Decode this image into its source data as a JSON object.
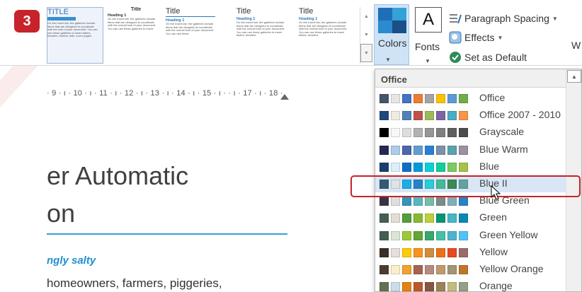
{
  "step_badge": "3",
  "ribbon": {
    "styles": [
      {
        "title": "TITLE",
        "heading": "",
        "body": "On the Insert tab, the galleries include items that are designed to coordinate with the look of your document. You can use these galleries to insert tables, headers, footers, lists, cover pages."
      },
      {
        "title": "Title",
        "heading": "Heading 1",
        "body": "On the Insert tab, the galleries include items that are designed to coordinate with the overall look of your document. You can use these galleries to insert"
      },
      {
        "title": "Title",
        "heading": "Heading 1",
        "body": "On the Insert tab, the galleries include items that are designed to coordinate with the overall look of your document. You can use these"
      },
      {
        "title": "Title",
        "heading": "Heading 1",
        "body": "On the Insert tab, the galleries include items that are designed to coordinate with the overall look of your document. You can use these galleries to insert tables, headers."
      },
      {
        "title": "Title",
        "heading": "Heading 1",
        "body": "On the Insert tab, the galleries include items that are designed to coordinate with the overall look of your document. You can use these galleries to insert tables, headers."
      }
    ],
    "colors_label": "Colors",
    "fonts_label": "Fonts",
    "fonts_glyph": "A",
    "paragraph_spacing": "Paragraph Spacing",
    "effects": "Effects",
    "set_as_default": "Set as Default",
    "w_fragment": "W"
  },
  "ruler": "· 9 · ı · 10 · ı · 11 · ı · 12 · ı · 13 · ı · 14 · ı · 15 · ı ·     · ı · 17 · ı · 18 ·",
  "document": {
    "title_line1": "er Automatic",
    "title_line2": "on",
    "subtitle": "ngly salty",
    "body": "homeowners, farmers, piggeries,"
  },
  "dropdown": {
    "header": "Office",
    "selected_index": 5,
    "themes": [
      {
        "name": "Office",
        "colors": [
          "#44546a",
          "#e7e6e6",
          "#4472c4",
          "#ed7d31",
          "#a5a5a5",
          "#ffc000",
          "#5b9bd5",
          "#70ad47"
        ]
      },
      {
        "name": "Office 2007 - 2010",
        "colors": [
          "#1f497d",
          "#eeece1",
          "#4f81bd",
          "#c0504d",
          "#9bbb59",
          "#8064a2",
          "#4bacc6",
          "#f79646"
        ]
      },
      {
        "name": "Grayscale",
        "colors": [
          "#000000",
          "#f8f8f8",
          "#dddddd",
          "#b2b2b2",
          "#969696",
          "#808080",
          "#5f5f5f",
          "#4d4d4d"
        ]
      },
      {
        "name": "Blue Warm",
        "colors": [
          "#242852",
          "#acccea",
          "#4a66ac",
          "#629dd1",
          "#297fd5",
          "#7f8fa9",
          "#5aa2ae",
          "#9d90a0"
        ]
      },
      {
        "name": "Blue",
        "colors": [
          "#17406d",
          "#dbeff9",
          "#0f6fc6",
          "#009dd9",
          "#0bd0d9",
          "#10cf9b",
          "#7cca62",
          "#a5c249"
        ]
      },
      {
        "name": "Blue II",
        "colors": [
          "#335b74",
          "#dfe3e5",
          "#1cade4",
          "#2683c6",
          "#27ced7",
          "#42ba97",
          "#3e8853",
          "#62a39f"
        ]
      },
      {
        "name": "Blue Green",
        "colors": [
          "#373545",
          "#dedede",
          "#3494ba",
          "#58b6c0",
          "#75bda7",
          "#7a8c8e",
          "#84acb6",
          "#2683c6"
        ]
      },
      {
        "name": "Green",
        "colors": [
          "#455f51",
          "#e3ded1",
          "#549e39",
          "#8ab833",
          "#c0cf3a",
          "#029676",
          "#4ab5c4",
          "#0989b1"
        ]
      },
      {
        "name": "Green Yellow",
        "colors": [
          "#455f51",
          "#dbe4d5",
          "#99cb38",
          "#63a537",
          "#37a76f",
          "#44c1a3",
          "#4eb3cf",
          "#51c3f9"
        ]
      },
      {
        "name": "Yellow",
        "colors": [
          "#39302a",
          "#e5dedb",
          "#ffca08",
          "#f8931d",
          "#ce8d3e",
          "#ec7016",
          "#e64823",
          "#9c6a6a"
        ]
      },
      {
        "name": "Yellow Orange",
        "colors": [
          "#4e3b30",
          "#fbeec9",
          "#f0a22e",
          "#a5644e",
          "#b58b80",
          "#c3986d",
          "#a19574",
          "#c17529"
        ]
      },
      {
        "name": "Orange",
        "colors": [
          "#637052",
          "#ccddea",
          "#e48312",
          "#bd582c",
          "#865640",
          "#9b8357",
          "#c2bc80",
          "#94a088"
        ]
      }
    ]
  }
}
